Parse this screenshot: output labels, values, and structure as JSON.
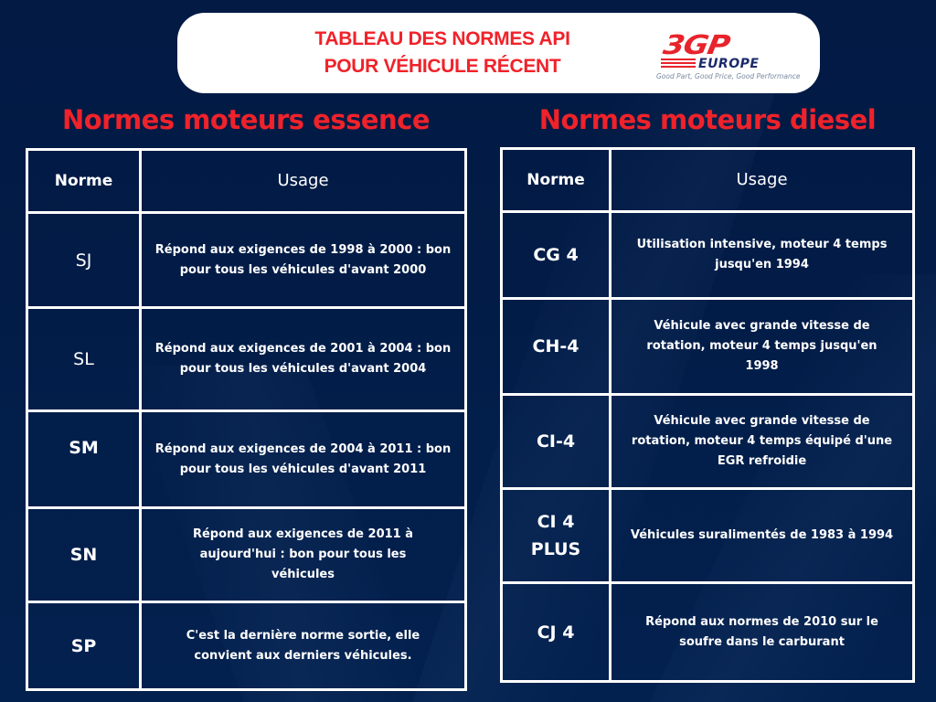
{
  "header": {
    "title_line1": "TABLEAU DES NORMES API",
    "title_line2": "POUR VÉHICULE RÉCENT",
    "logo": {
      "brand": "3GP",
      "sub": "EUROPE",
      "tagline": "Good Part, Good Price, Good Performance"
    }
  },
  "colors": {
    "background": "#021c47",
    "accent_red": "#f0222a",
    "card": "#ffffff",
    "text": "#ffffff"
  },
  "essence": {
    "title": "Normes moteurs essence",
    "columns": [
      "Norme",
      "Usage"
    ],
    "rows": [
      {
        "norme": "SJ",
        "usage": "Répond aux exigences de 1998 à 2000 : bon pour tous les véhicules d'avant 2000"
      },
      {
        "norme": "SL",
        "usage": "Répond aux exigences de 2001 à 2004 : bon pour tous les véhicules d'avant 2004"
      },
      {
        "norme": "SM",
        "usage": "Répond aux exigences de 2004 à 2011 : bon pour tous les véhicules d'avant 2011"
      },
      {
        "norme": "SN",
        "usage": "Répond aux exigences de 2011 à aujourd'hui : bon pour tous les véhicules"
      },
      {
        "norme": "SP",
        "usage": "C'est la dernière norme sortie, elle convient aux derniers véhicules."
      }
    ]
  },
  "diesel": {
    "title": "Normes moteurs diesel",
    "columns": [
      "Norme",
      "Usage"
    ],
    "rows": [
      {
        "norme": "CG 4",
        "usage": "Utilisation intensive, moteur 4 temps jusqu'en 1994"
      },
      {
        "norme": "CH-4",
        "usage": "Véhicule avec grande vitesse de rotation, moteur 4 temps jusqu'en 1998"
      },
      {
        "norme": "CI-4",
        "usage": "Véhicule avec grande vitesse de rotation, moteur 4 temps équipé d'une EGR refroidie"
      },
      {
        "norme": "CI 4 PLUS",
        "usage": "Véhicules suralimentés de 1983 à 1994"
      },
      {
        "norme": "CJ 4",
        "usage": "Répond aux normes de 2010 sur le soufre dans le carburant"
      }
    ]
  }
}
